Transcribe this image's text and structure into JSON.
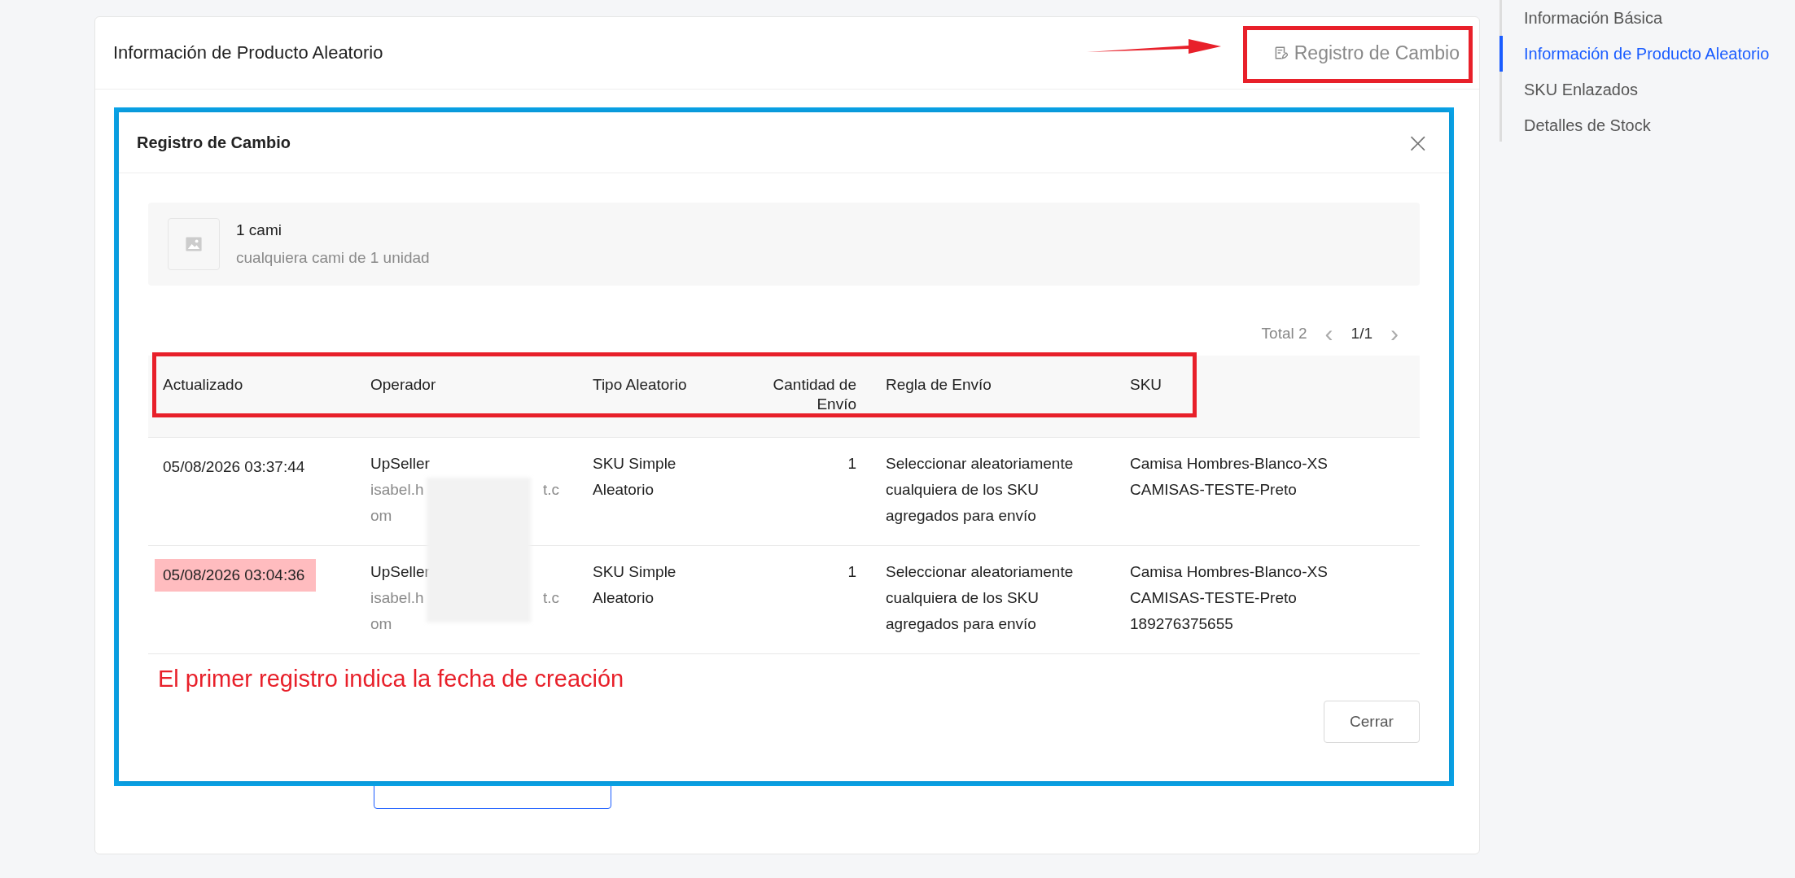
{
  "card": {
    "title": "Información de Producto Aleatorio",
    "change_log_link": "Registro de Cambio"
  },
  "sidebar": {
    "items": [
      {
        "label": "Información Básica",
        "selected": false
      },
      {
        "label": "Información de Producto Aleatorio",
        "selected": true
      },
      {
        "label": "SKU Enlazados",
        "selected": false
      },
      {
        "label": "Detalles de Stock",
        "selected": false
      }
    ]
  },
  "modal": {
    "title": "Registro de Cambio",
    "close": "×",
    "product": {
      "name": "1 cami",
      "description": "cualquiera cami de 1 unidad"
    },
    "pagination": {
      "total": "Total 2",
      "prev": "‹",
      "page": "1/1",
      "next": "›"
    },
    "table": {
      "columns": [
        "Actualizado",
        "Operador",
        "Tipo Aleatorio",
        "Cantidad de Envío",
        "Regla de Envío",
        "SKU"
      ],
      "rows": [
        {
          "updated": "05/08/2026 03:37:44",
          "highlighted": false,
          "operator": "UpSeller",
          "email_start": "isabel.h",
          "email_end": "t.c",
          "email_tail": "om",
          "type": "SKU Simple Aleatorio",
          "quantity": "1",
          "rule": "Seleccionar aleatoriamente cualquiera de los SKU agregados para envío",
          "skus": [
            "Camisa Hombres-Blanco-XS",
            "CAMISAS-TESTE-Preto"
          ]
        },
        {
          "updated": "05/08/2026 03:04:36",
          "highlighted": true,
          "operator": "UpSeller",
          "email_start": "isabel.h",
          "email_end": "t.c",
          "email_tail": "om",
          "type": "SKU Simple Aleatorio",
          "quantity": "1",
          "rule": "Seleccionar aleatoriamente cualquiera de los SKU agregados para envío",
          "skus": [
            "Camisa Hombres-Blanco-XS",
            "CAMISAS-TESTE-Preto",
            "189276375655"
          ]
        }
      ]
    },
    "annotation": "El primer registro indica la fecha de creación",
    "close_button": "Cerrar"
  }
}
